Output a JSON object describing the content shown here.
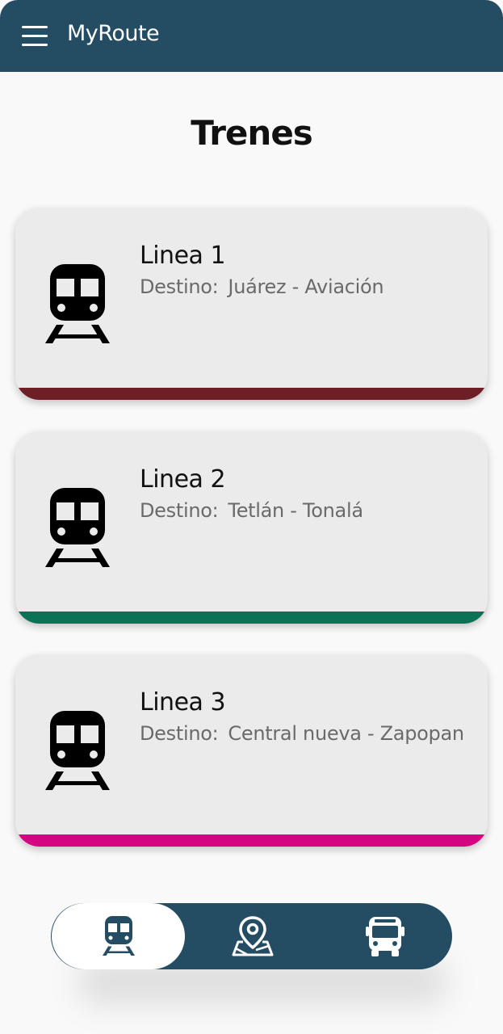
{
  "app": {
    "title": "MyRoute"
  },
  "page": {
    "title": "Trenes"
  },
  "lines": [
    {
      "name": "Linea 1",
      "dest_label": "Destino:",
      "destination": "Juárez - Aviación",
      "color": "#6e1f26"
    },
    {
      "name": "Linea 2",
      "dest_label": "Destino:",
      "destination": "Tetlán - Tonalá",
      "color": "#0b7256"
    },
    {
      "name": "Linea 3",
      "dest_label": "Destino:",
      "destination": "Central nueva - Zapopan",
      "color": "#d4037f"
    }
  ],
  "bottom_nav": {
    "items": [
      {
        "icon": "train-icon",
        "active": true
      },
      {
        "icon": "map-pin-icon",
        "active": false
      },
      {
        "icon": "bus-icon",
        "active": false
      }
    ]
  },
  "colors": {
    "primary": "#244d63",
    "background": "#f9f9f9",
    "card": "#ebebeb"
  }
}
